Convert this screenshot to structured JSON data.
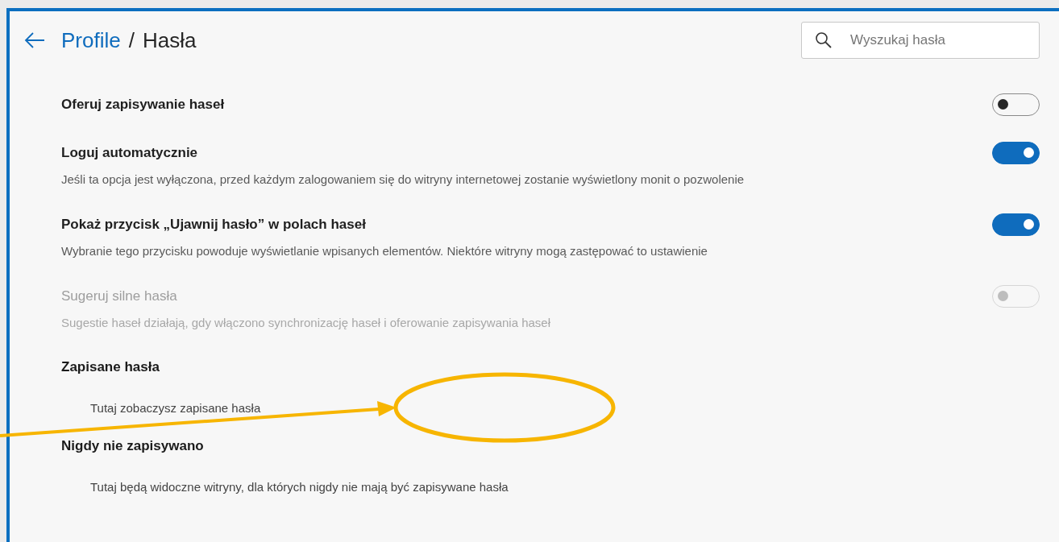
{
  "header": {
    "breadcrumb_link": "Profile",
    "separator": "/",
    "title": "Hasła"
  },
  "search": {
    "placeholder": "Wyszukaj hasła"
  },
  "settings": [
    {
      "kind": "toggle",
      "label": "Oferuj zapisywanie haseł",
      "on": false,
      "disabled": false
    },
    {
      "kind": "toggle",
      "label": "Loguj automatycznie",
      "description": "Jeśli ta opcja jest wyłączona, przed każdym zalogowaniem się do witryny internetowej zostanie wyświetlony monit o pozwolenie",
      "on": true,
      "disabled": false
    },
    {
      "kind": "toggle",
      "label": "Pokaż przycisk „Ujawnij hasło” w polach haseł",
      "description": "Wybranie tego przycisku powoduje wyświetlanie wpisanych elementów. Niektóre witryny mogą zastępować to ustawienie",
      "on": true,
      "disabled": false
    },
    {
      "kind": "toggle",
      "label": "Sugeruj silne hasła",
      "description": "Sugestie haseł działają, gdy włączono synchronizację haseł i oferowanie zapisywania haseł",
      "on": false,
      "disabled": true
    }
  ],
  "sections": [
    {
      "title": "Zapisane hasła",
      "empty_text": "Tutaj zobaczysz zapisane hasła"
    },
    {
      "title": "Nigdy nie zapisywano",
      "empty_text": "Tutaj będą widoczne witryny, dla których nigdy nie mają być zapisywane hasła"
    }
  ]
}
